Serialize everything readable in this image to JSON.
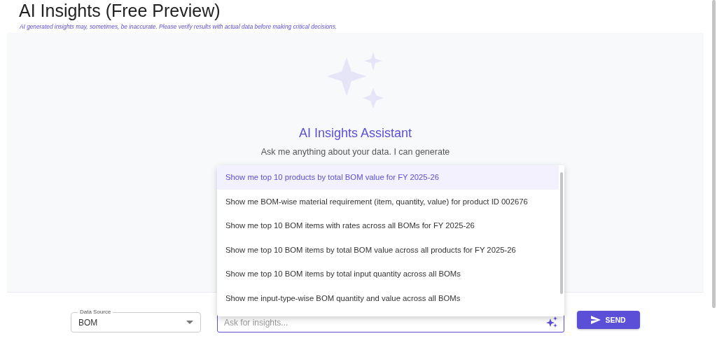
{
  "page": {
    "title": "AI Insights (Free Preview)",
    "disclaimer": "AI generated insights may, sometimes, be inaccurate. Please verify results with actual data before making critical decisions."
  },
  "assistant": {
    "heading": "AI Insights Assistant",
    "description": "Ask me anything about your data. I can generate"
  },
  "suggestions": [
    {
      "text": "Show me top 10 products by total BOM value for FY 2025-26",
      "selected": true
    },
    {
      "text": "Show me BOM-wise material requirement (item, quantity, value) for product ID 002676",
      "selected": false
    },
    {
      "text": "Show me top 10 BOM items with rates across all BOMs for FY 2025-26",
      "selected": false
    },
    {
      "text": "Show me top 10 BOM items by total BOM value across all products for FY 2025-26",
      "selected": false
    },
    {
      "text": "Show me top 10 BOM items by total input quantity across all BOMs",
      "selected": false
    },
    {
      "text": "Show me input-type-wise BOM quantity and value across all BOMs",
      "selected": false
    }
  ],
  "data_source": {
    "label": "Data Source",
    "value": "BOM"
  },
  "query": {
    "placeholder": "Ask for insights..."
  },
  "send_button": "SEND"
}
